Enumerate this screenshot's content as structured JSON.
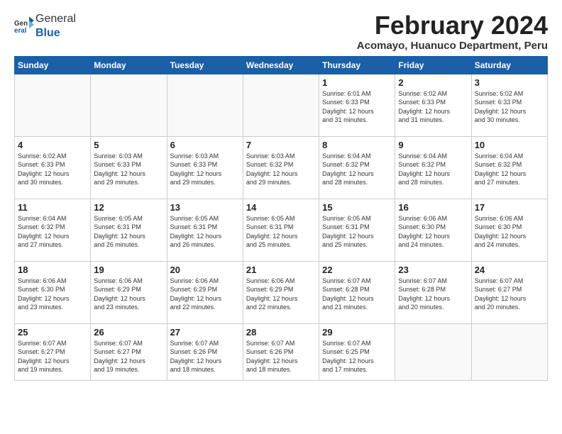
{
  "app": {
    "logo_general": "General",
    "logo_blue": "Blue"
  },
  "header": {
    "month_year": "February 2024",
    "location": "Acomayo, Huanuco Department, Peru"
  },
  "days_of_week": [
    "Sunday",
    "Monday",
    "Tuesday",
    "Wednesday",
    "Thursday",
    "Friday",
    "Saturday"
  ],
  "weeks": [
    [
      {
        "day": "",
        "info": ""
      },
      {
        "day": "",
        "info": ""
      },
      {
        "day": "",
        "info": ""
      },
      {
        "day": "",
        "info": ""
      },
      {
        "day": "1",
        "info": "Sunrise: 6:01 AM\nSunset: 6:33 PM\nDaylight: 12 hours\nand 31 minutes."
      },
      {
        "day": "2",
        "info": "Sunrise: 6:02 AM\nSunset: 6:33 PM\nDaylight: 12 hours\nand 31 minutes."
      },
      {
        "day": "3",
        "info": "Sunrise: 6:02 AM\nSunset: 6:33 PM\nDaylight: 12 hours\nand 30 minutes."
      }
    ],
    [
      {
        "day": "4",
        "info": "Sunrise: 6:02 AM\nSunset: 6:33 PM\nDaylight: 12 hours\nand 30 minutes."
      },
      {
        "day": "5",
        "info": "Sunrise: 6:03 AM\nSunset: 6:33 PM\nDaylight: 12 hours\nand 29 minutes."
      },
      {
        "day": "6",
        "info": "Sunrise: 6:03 AM\nSunset: 6:33 PM\nDaylight: 12 hours\nand 29 minutes."
      },
      {
        "day": "7",
        "info": "Sunrise: 6:03 AM\nSunset: 6:32 PM\nDaylight: 12 hours\nand 29 minutes."
      },
      {
        "day": "8",
        "info": "Sunrise: 6:04 AM\nSunset: 6:32 PM\nDaylight: 12 hours\nand 28 minutes."
      },
      {
        "day": "9",
        "info": "Sunrise: 6:04 AM\nSunset: 6:32 PM\nDaylight: 12 hours\nand 28 minutes."
      },
      {
        "day": "10",
        "info": "Sunrise: 6:04 AM\nSunset: 6:32 PM\nDaylight: 12 hours\nand 27 minutes."
      }
    ],
    [
      {
        "day": "11",
        "info": "Sunrise: 6:04 AM\nSunset: 6:32 PM\nDaylight: 12 hours\nand 27 minutes."
      },
      {
        "day": "12",
        "info": "Sunrise: 6:05 AM\nSunset: 6:31 PM\nDaylight: 12 hours\nand 26 minutes."
      },
      {
        "day": "13",
        "info": "Sunrise: 6:05 AM\nSunset: 6:31 PM\nDaylight: 12 hours\nand 26 minutes."
      },
      {
        "day": "14",
        "info": "Sunrise: 6:05 AM\nSunset: 6:31 PM\nDaylight: 12 hours\nand 25 minutes."
      },
      {
        "day": "15",
        "info": "Sunrise: 6:05 AM\nSunset: 6:31 PM\nDaylight: 12 hours\nand 25 minutes."
      },
      {
        "day": "16",
        "info": "Sunrise: 6:06 AM\nSunset: 6:30 PM\nDaylight: 12 hours\nand 24 minutes."
      },
      {
        "day": "17",
        "info": "Sunrise: 6:06 AM\nSunset: 6:30 PM\nDaylight: 12 hours\nand 24 minutes."
      }
    ],
    [
      {
        "day": "18",
        "info": "Sunrise: 6:06 AM\nSunset: 6:30 PM\nDaylight: 12 hours\nand 23 minutes."
      },
      {
        "day": "19",
        "info": "Sunrise: 6:06 AM\nSunset: 6:29 PM\nDaylight: 12 hours\nand 23 minutes."
      },
      {
        "day": "20",
        "info": "Sunrise: 6:06 AM\nSunset: 6:29 PM\nDaylight: 12 hours\nand 22 minutes."
      },
      {
        "day": "21",
        "info": "Sunrise: 6:06 AM\nSunset: 6:29 PM\nDaylight: 12 hours\nand 22 minutes."
      },
      {
        "day": "22",
        "info": "Sunrise: 6:07 AM\nSunset: 6:28 PM\nDaylight: 12 hours\nand 21 minutes."
      },
      {
        "day": "23",
        "info": "Sunrise: 6:07 AM\nSunset: 6:28 PM\nDaylight: 12 hours\nand 20 minutes."
      },
      {
        "day": "24",
        "info": "Sunrise: 6:07 AM\nSunset: 6:27 PM\nDaylight: 12 hours\nand 20 minutes."
      }
    ],
    [
      {
        "day": "25",
        "info": "Sunrise: 6:07 AM\nSunset: 6:27 PM\nDaylight: 12 hours\nand 19 minutes."
      },
      {
        "day": "26",
        "info": "Sunrise: 6:07 AM\nSunset: 6:27 PM\nDaylight: 12 hours\nand 19 minutes."
      },
      {
        "day": "27",
        "info": "Sunrise: 6:07 AM\nSunset: 6:26 PM\nDaylight: 12 hours\nand 18 minutes."
      },
      {
        "day": "28",
        "info": "Sunrise: 6:07 AM\nSunset: 6:26 PM\nDaylight: 12 hours\nand 18 minutes."
      },
      {
        "day": "29",
        "info": "Sunrise: 6:07 AM\nSunset: 6:25 PM\nDaylight: 12 hours\nand 17 minutes."
      },
      {
        "day": "",
        "info": ""
      },
      {
        "day": "",
        "info": ""
      }
    ]
  ]
}
